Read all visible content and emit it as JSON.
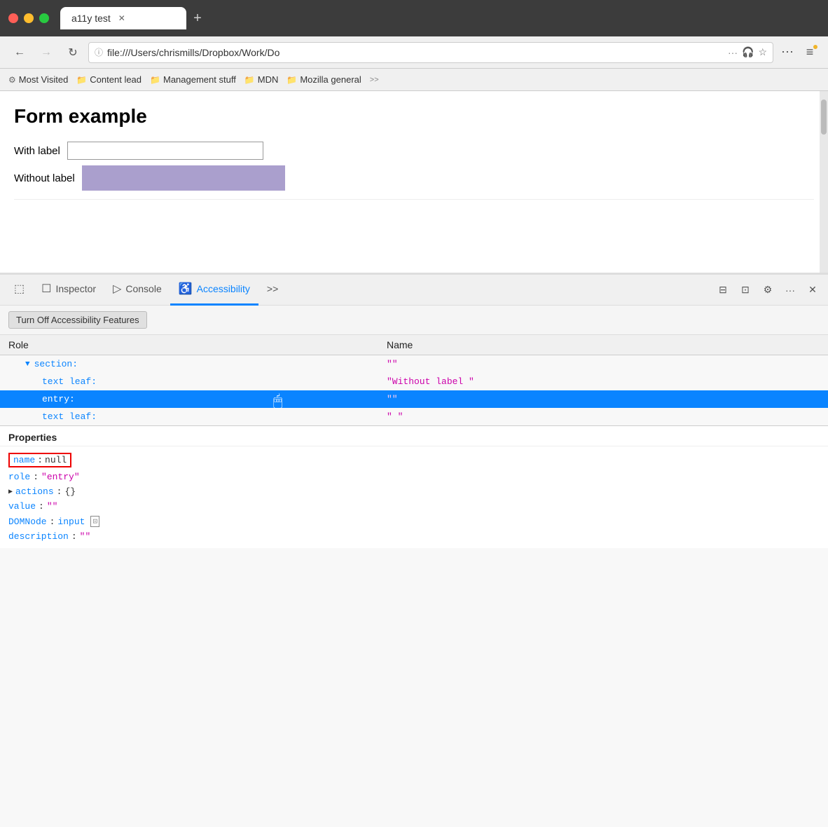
{
  "titlebar": {
    "tab_title": "a11y test",
    "new_tab_label": "+"
  },
  "navbar": {
    "address": "file:///Users/chrismills/Dropbox/Work/Do",
    "back_label": "←",
    "forward_label": "→",
    "reload_label": "↻"
  },
  "bookmarks": {
    "items": [
      {
        "label": "Most Visited",
        "icon": "⚙"
      },
      {
        "label": "Content lead",
        "icon": "📁"
      },
      {
        "label": "Management stuff",
        "icon": "📁"
      },
      {
        "label": "MDN",
        "icon": "📁"
      },
      {
        "label": "Mozilla general",
        "icon": "📁"
      }
    ],
    "more_label": ">>"
  },
  "page": {
    "title": "Form example",
    "form_rows": [
      {
        "label": "With label",
        "type": "normal"
      },
      {
        "label": "Without label",
        "type": "highlighted"
      }
    ]
  },
  "devtools": {
    "tabs": [
      {
        "label": "",
        "icon": "⬚",
        "type": "responsive"
      },
      {
        "label": "Inspector",
        "icon": "☐"
      },
      {
        "label": "Console",
        "icon": "▷"
      },
      {
        "label": "Accessibility",
        "icon": "♿",
        "active": true
      }
    ],
    "more_tabs_label": ">>",
    "toolbar_label": "Turn Off Accessibility Features",
    "tree_headers": {
      "role": "Role",
      "name": "Name"
    },
    "tree_rows": [
      {
        "indent": 1,
        "has_arrow": true,
        "role": "section:",
        "name": "\"\"",
        "selected": false
      },
      {
        "indent": 2,
        "has_arrow": false,
        "role": "text leaf:",
        "name": "\"Without label \"",
        "selected": false
      },
      {
        "indent": 2,
        "has_arrow": false,
        "role": "entry:",
        "name": "\"\"",
        "selected": true
      },
      {
        "indent": 2,
        "has_arrow": false,
        "role": "text leaf:",
        "name": "\" \"",
        "selected": false
      }
    ],
    "properties_header": "Properties",
    "properties": [
      {
        "type": "highlighted",
        "key": "name",
        "colon": ":",
        "value": "null"
      },
      {
        "type": "normal",
        "key": "role",
        "colon": ":",
        "value": "\"entry\""
      },
      {
        "type": "expandable",
        "key": "actions",
        "colon": ":",
        "value": "{}"
      },
      {
        "type": "normal",
        "key": "value",
        "colon": ":",
        "value": "\"\""
      },
      {
        "type": "domnode",
        "key": "DOMNode",
        "colon": ":",
        "value": "input"
      },
      {
        "type": "normal",
        "key": "description",
        "colon": ":",
        "value": "\"\""
      }
    ]
  }
}
